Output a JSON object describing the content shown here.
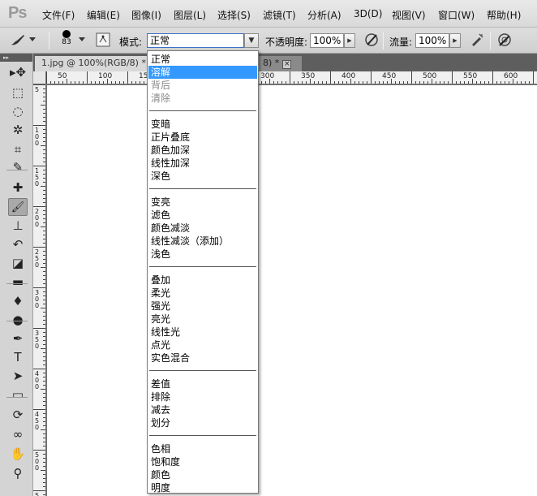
{
  "app": {
    "logo": "Ps"
  },
  "menu": [
    "文件(F)",
    "编辑(E)",
    "图像(I)",
    "图层(L)",
    "选择(S)",
    "滤镜(T)",
    "分析(A)",
    "3D(D)",
    "视图(V)",
    "窗口(W)",
    "帮助(H)"
  ],
  "options": {
    "brush_size": "83",
    "mode_label": "模式:",
    "mode_value": "正常",
    "opacity_label": "不透明度:",
    "opacity_value": "100%",
    "flow_label": "流量:",
    "flow_value": "100%"
  },
  "document": {
    "tab_title": "1.jpg @ 100%(RGB/8) *",
    "tab2_title": "8) *",
    "close_glyph": "×",
    "ruler_top": [
      "50",
      "100",
      "15",
      "300",
      "350",
      "400",
      "450",
      "500",
      "550",
      "600"
    ],
    "ruler_left": [
      "5",
      "1\n0\n0",
      "1\n5\n0",
      "2\n0\n0",
      "2\n5\n0",
      "3\n0\n0",
      "3\n5\n0",
      "4\n0\n0",
      "4\n5\n0",
      "5\n0\n0",
      "5\n5\n0"
    ]
  },
  "blend_modes": [
    {
      "label": "正常",
      "disabled": false,
      "selected": false,
      "group": 0
    },
    {
      "label": "溶解",
      "disabled": false,
      "selected": true,
      "group": 0
    },
    {
      "label": "背后",
      "disabled": true,
      "selected": false,
      "group": 0
    },
    {
      "label": "清除",
      "disabled": true,
      "selected": false,
      "group": 0
    },
    {
      "label": "变暗",
      "disabled": false,
      "selected": false,
      "group": 1
    },
    {
      "label": "正片叠底",
      "disabled": false,
      "selected": false,
      "group": 1
    },
    {
      "label": "颜色加深",
      "disabled": false,
      "selected": false,
      "group": 1
    },
    {
      "label": "线性加深",
      "disabled": false,
      "selected": false,
      "group": 1
    },
    {
      "label": "深色",
      "disabled": false,
      "selected": false,
      "group": 1
    },
    {
      "label": "变亮",
      "disabled": false,
      "selected": false,
      "group": 2
    },
    {
      "label": "滤色",
      "disabled": false,
      "selected": false,
      "group": 2
    },
    {
      "label": "颜色减淡",
      "disabled": false,
      "selected": false,
      "group": 2
    },
    {
      "label": "线性减淡（添加）",
      "disabled": false,
      "selected": false,
      "group": 2
    },
    {
      "label": "浅色",
      "disabled": false,
      "selected": false,
      "group": 2
    },
    {
      "label": "叠加",
      "disabled": false,
      "selected": false,
      "group": 3
    },
    {
      "label": "柔光",
      "disabled": false,
      "selected": false,
      "group": 3
    },
    {
      "label": "强光",
      "disabled": false,
      "selected": false,
      "group": 3
    },
    {
      "label": "亮光",
      "disabled": false,
      "selected": false,
      "group": 3
    },
    {
      "label": "线性光",
      "disabled": false,
      "selected": false,
      "group": 3
    },
    {
      "label": "点光",
      "disabled": false,
      "selected": false,
      "group": 3
    },
    {
      "label": "实色混合",
      "disabled": false,
      "selected": false,
      "group": 3
    },
    {
      "label": "差值",
      "disabled": false,
      "selected": false,
      "group": 4
    },
    {
      "label": "排除",
      "disabled": false,
      "selected": false,
      "group": 4
    },
    {
      "label": "减去",
      "disabled": false,
      "selected": false,
      "group": 4
    },
    {
      "label": "划分",
      "disabled": false,
      "selected": false,
      "group": 4
    },
    {
      "label": "色相",
      "disabled": false,
      "selected": false,
      "group": 5
    },
    {
      "label": "饱和度",
      "disabled": false,
      "selected": false,
      "group": 5
    },
    {
      "label": "颜色",
      "disabled": false,
      "selected": false,
      "group": 5
    },
    {
      "label": "明度",
      "disabled": false,
      "selected": false,
      "group": 5
    }
  ],
  "tools": [
    "move-tool",
    "marquee-tool",
    "lasso-tool",
    "magic-wand-tool",
    "crop-tool",
    "eyedropper-tool",
    "spot-healing-tool",
    "brush-tool",
    "clone-stamp-tool",
    "history-brush-tool",
    "eraser-tool",
    "gradient-tool",
    "blur-tool",
    "dodge-tool",
    "pen-tool",
    "type-tool",
    "path-selection-tool",
    "shape-tool",
    "3d-rotate-tool",
    "3d-orbit-tool",
    "hand-tool",
    "zoom-tool"
  ],
  "colors": {
    "selection": "#3399ff",
    "active_tool": "#a9a9a9"
  }
}
